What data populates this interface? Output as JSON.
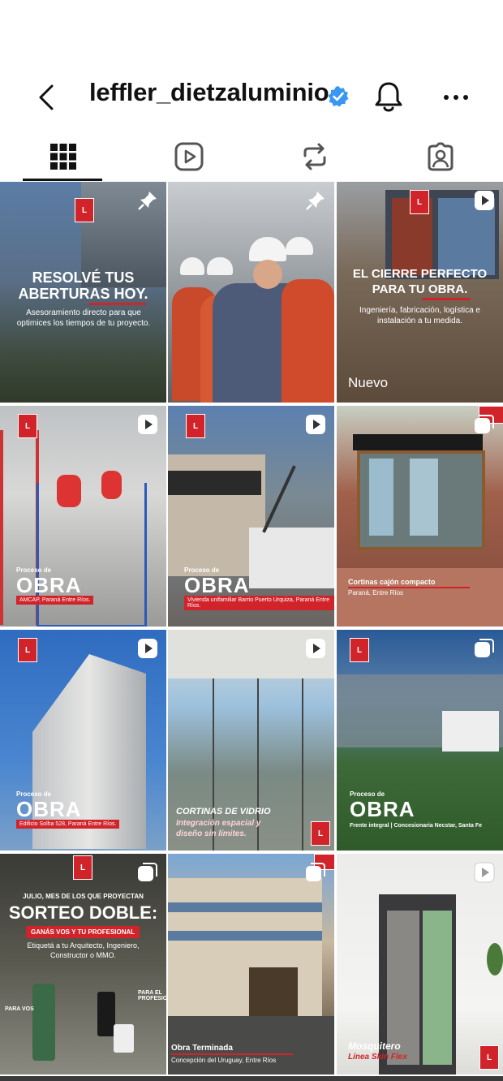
{
  "header": {
    "username": "leffler_dietzaluminio"
  },
  "tabs": [
    {
      "name": "grid"
    },
    {
      "name": "reels"
    },
    {
      "name": "reposts"
    },
    {
      "name": "tagged"
    }
  ],
  "posts": [
    {
      "headline1": "RESOLVÉ TUS",
      "headline2": "ABERTURAS HOY.",
      "sub": "Asesoramiento directo para que optimices los tiempos de tu proyecto.",
      "icon": "pin-icon"
    },
    {
      "icon": "pin-icon"
    },
    {
      "headline1": "EL CIERRE PERFECTO",
      "headline2": "PARA TU OBRA.",
      "sub": "Ingeniería, fabricación, logística e instalación a tu medida.",
      "new_label": "Nuevo",
      "icon": "reel-icon"
    },
    {
      "pre": "Proceso de",
      "big": "OBRA",
      "caption": "AMCAP, Paraná Entre Ríos.",
      "icon": "reel-icon"
    },
    {
      "pre": "Proceso de",
      "big": "OBRA",
      "caption": "Vivienda unifamiliar Barrio Puerto Urquiza, Paraná Entre Ríos.",
      "icon": "reel-icon"
    },
    {
      "headline1": "Cortinas cajón compacto",
      "sub": "Paraná, Entre Ríos",
      "icon": "carousel-icon"
    },
    {
      "pre": "Proceso de",
      "big": "OBRA",
      "caption": "Edificio Solha 528, Paraná Entre Ríos.",
      "icon": "reel-icon"
    },
    {
      "headline1": "CORTINAS DE VIDRIO",
      "headline2": "Integración espacial y",
      "headline3": "diseño sin límites.",
      "icon": "reel-icon"
    },
    {
      "pre": "Proceso de",
      "big": "OBRA",
      "caption": "Frente integral | Concesionaria Necstar, Santa Fe",
      "icon": "carousel-icon"
    },
    {
      "top": "JULIO, MES DE LOS QUE PROYECTAN",
      "big": "SORTEO DOBLE:",
      "pill": "GANÁS VOS Y TU PROFESIONAL",
      "sub": "Etiquetá a tu Arquitecto, Ingeniero, Constructor o MMO.",
      "left_tag": "PARA VOS",
      "right_tag": "PARA EL PROFESIONAL",
      "icon": "carousel-icon"
    },
    {
      "headline1": "Obra Terminada",
      "sub": "Concepción del Uruguay, Entre Ríos",
      "icon": "carousel-icon"
    },
    {
      "headline1": "Mosquitero",
      "headline2": "Línea Skin Flex",
      "icon": "reel-icon"
    }
  ]
}
